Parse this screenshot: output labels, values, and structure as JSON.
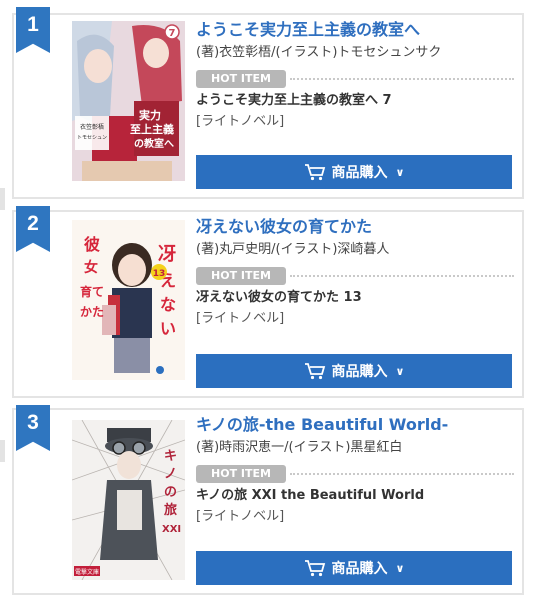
{
  "ranking": [
    {
      "rank": "1",
      "title": "ようこそ実力至上主義の教室へ",
      "author": "(著)衣笠彰梧/(イラスト)トモセシュンサク",
      "hot_label": "HOT ITEM",
      "product_name": "ようこそ実力至上主義の教室へ 7",
      "label": "[ライトノベル]",
      "button_label": "商品購入",
      "cover": {
        "volume_mark": "7",
        "logo_text": "ようこそ実力至上主義の教室へ",
        "author_tag": "衣笠彰梧"
      }
    },
    {
      "rank": "2",
      "title": "冴えない彼女の育てかた",
      "author": "(著)丸戸史明/(イラスト)深崎暮人",
      "hot_label": "HOT ITEM",
      "product_name": "冴えない彼女の育てかた 13",
      "label": "[ライトノベル]",
      "button_label": "商品購入",
      "cover": {
        "volume_mark": "13",
        "logo_text_left": "彼女の育てかた",
        "logo_text_right": "冴えない"
      }
    },
    {
      "rank": "3",
      "title": "キノの旅-the Beautiful World-",
      "author": "(著)時雨沢恵一/(イラスト)黒星紅白",
      "hot_label": "HOT ITEM",
      "product_name": "キノの旅 XXI the Beautiful World",
      "label": "[ライトノベル]",
      "button_label": "商品購入",
      "cover": {
        "volume_mark": "XXI",
        "logo_text": "キノの旅",
        "publisher": "電撃文庫"
      }
    }
  ],
  "colors": {
    "accent": "#2f76c0",
    "button": "#2b6fbf",
    "badge": "#b7b7b7",
    "border": "#e4e4e4"
  }
}
